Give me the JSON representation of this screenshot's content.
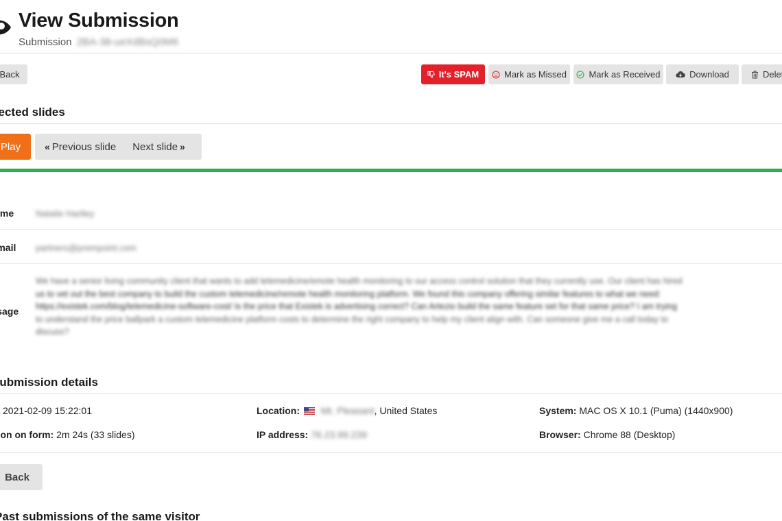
{
  "header": {
    "title": "View Submission",
    "subtitle_label": "Submission",
    "submission_id": "2BA-38-ueXdBsQ0M6"
  },
  "toolbar": {
    "back_label": "Back",
    "spam_label": "It's SPAM",
    "missed_label": "Mark as Missed",
    "received_label": "Mark as Received",
    "download_label": "Download",
    "delete_label": "Delete"
  },
  "slides": {
    "section_title": "Selected slides",
    "play_label": "Play",
    "prev_label": "Previous slide",
    "next_label": "Next slide",
    "progress_fraction": 1.0
  },
  "fields": {
    "name": {
      "label": "Name",
      "value": "Natalie Hartley"
    },
    "email": {
      "label": "Email",
      "value": "partners@prempoint.com"
    },
    "message": {
      "label": "Message",
      "lines": [
        "We have a senior living community client that wants to add telemedicine/emote health monitoring to our access control solution that they currently use. Our client has hired",
        "us to vet out the best company to build the custom telemedicine/remote health monitoring platform. We found this company offering similar features to what we need:",
        "https://existek.com/blog/telemedicine-software-cost/ Is the price that Existek is advertising correct? Can Artezio build the same feature set for that same price? I am trying",
        "to understand the price ballpark a custom telemedicine platform costs to determine the right company to help my client align with. Can someone give me a call today to",
        "discuss?"
      ]
    }
  },
  "details": {
    "section_title": "Submission details",
    "date_value": "2021-02-09 15:22:01",
    "duration_label": "Duration on form:",
    "duration_value": "2m 24s (33 slides)",
    "location_label": "Location:",
    "location_city": "Mt. Pleasant",
    "location_country": ", United States",
    "ip_label": "IP address:",
    "ip_value": "76.23.99.239",
    "system_label": "System:",
    "system_value": "MAC OS X 10.1 (Puma) (1440x900)",
    "browser_label": "Browser:",
    "browser_value": "Chrome 88 (Desktop)"
  },
  "footer": {
    "back_label": "Back",
    "past_section_title": "Past submissions of the same visitor"
  },
  "colors": {
    "spam": "#e3212b",
    "play": "#f07019",
    "progress": "#27b24a"
  }
}
